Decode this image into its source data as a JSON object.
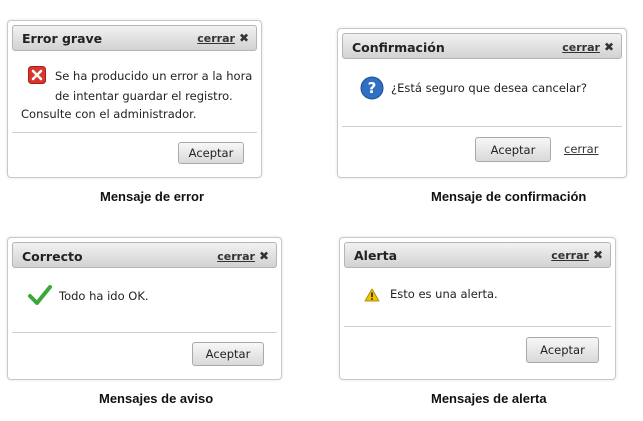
{
  "error_dialog": {
    "title": "Error grave",
    "close_label": "cerrar",
    "message_line1": "Se ha producido un error a la hora",
    "message_line2": "de intentar guardar el registro.",
    "message_line3": "Consulte con el administrador.",
    "accept_label": "Aceptar",
    "caption": "Mensaje de error",
    "icon": "error-icon"
  },
  "confirm_dialog": {
    "title": "Confirmación",
    "close_label": "cerrar",
    "message": "¿Está seguro que desea cancelar?",
    "accept_label": "Aceptar",
    "cancel_link": "cerrar",
    "caption": "Mensaje de confirmación",
    "icon": "question-icon"
  },
  "success_dialog": {
    "title": "Correcto",
    "close_label": "cerrar",
    "message": "Todo ha ido OK.",
    "accept_label": "Aceptar",
    "caption": "Mensajes de aviso",
    "icon": "checkmark-icon"
  },
  "alert_dialog": {
    "title": "Alerta",
    "close_label": "cerrar",
    "message": "Esto es una alerta.",
    "accept_label": "Aceptar",
    "caption": "Mensajes de alerta",
    "icon": "warning-icon"
  },
  "colors": {
    "error_red": "#d9352b",
    "question_blue": "#2f6fc4",
    "success_green": "#3aa83a",
    "warning_yellow": "#f2c200"
  }
}
